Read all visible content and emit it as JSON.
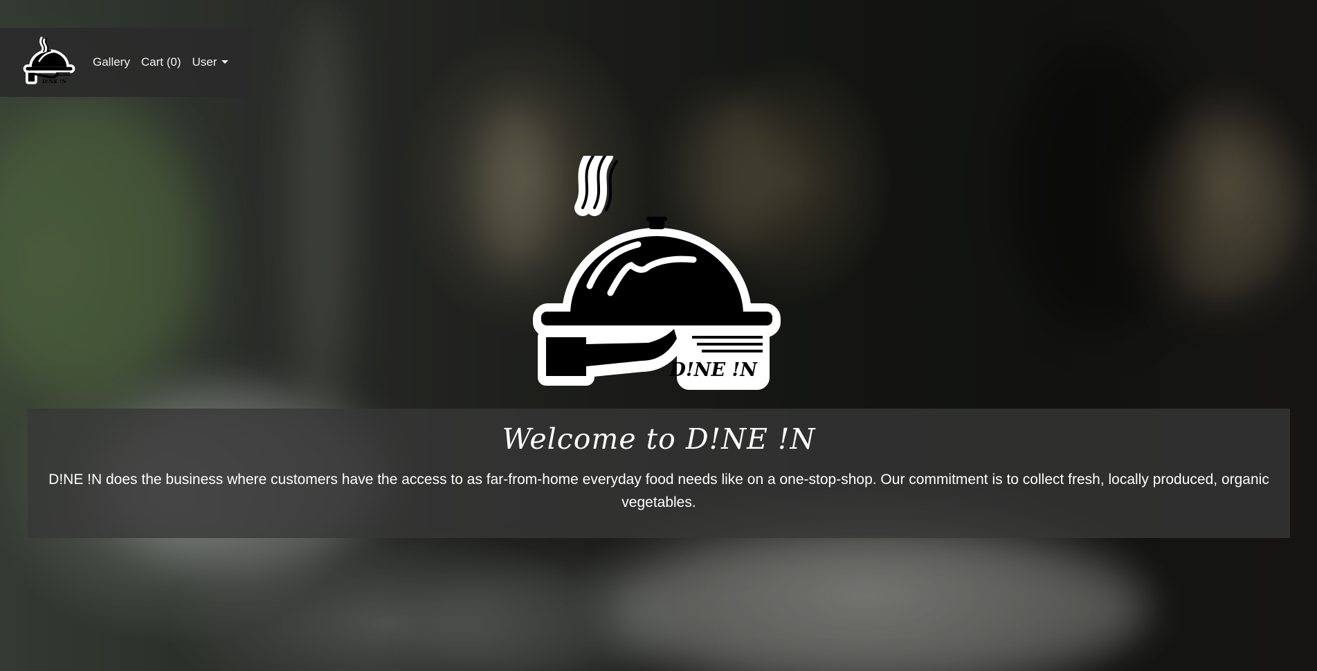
{
  "navbar": {
    "brand_logo_text": "D!NE !N",
    "links": [
      {
        "label": "Gallery"
      },
      {
        "label": "Cart (0)"
      },
      {
        "label": "User"
      }
    ]
  },
  "hero": {
    "logo_text": "D!NE !N",
    "title": "Welcome to D!NE !N",
    "description": "D!NE !N does the business where customers have the access to as far-from-home everyday food needs like on a one-stop-shop. Our commitment is to collect fresh, locally produced, organic vegetables."
  },
  "icons": {
    "brand": "cloche-serving-logo",
    "user_dropdown": "caret-down-icon"
  },
  "colors": {
    "navbar_bg": "#2a2a2a",
    "hero_box_bg": "#373737",
    "text": "#ffffff"
  }
}
